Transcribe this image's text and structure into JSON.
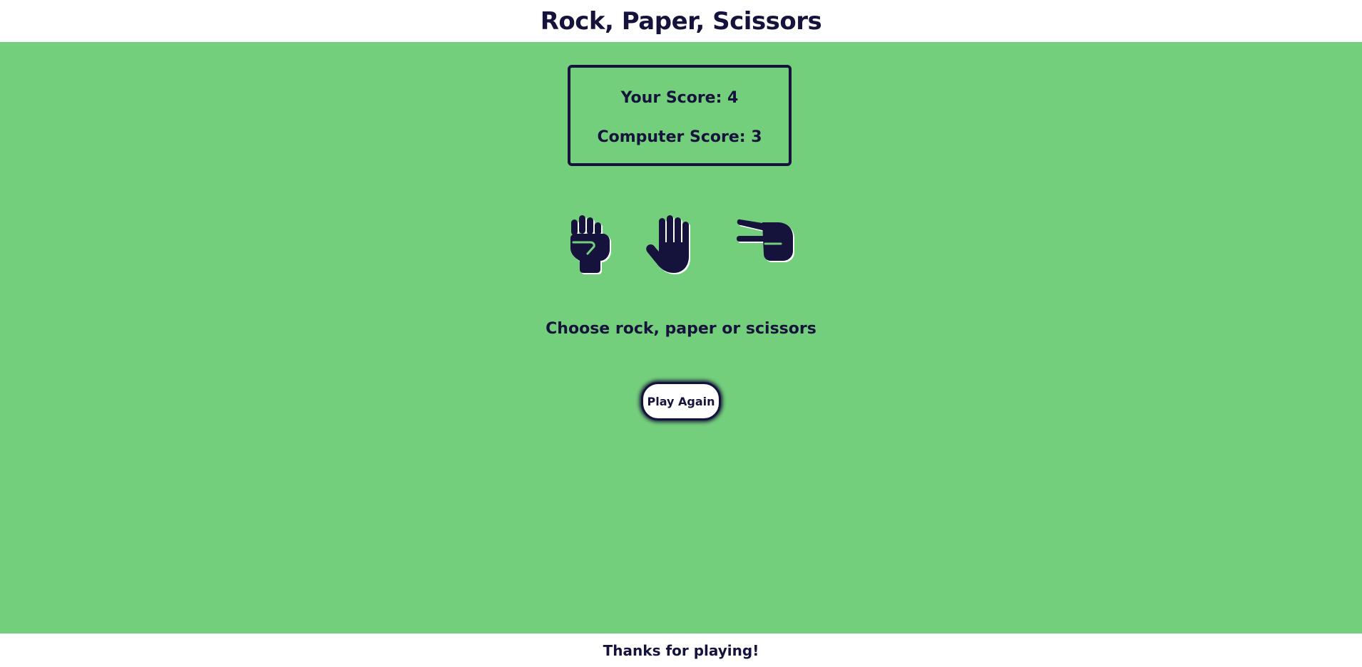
{
  "header": {
    "title": "Rock, Paper, Scissors"
  },
  "scoreboard": {
    "your_score_text": "Your Score: 4",
    "computer_score_text": "Computer Score: 3",
    "your_score": 4,
    "computer_score": 3
  },
  "choices": [
    {
      "name": "rock",
      "icon": "fist-icon"
    },
    {
      "name": "paper",
      "icon": "open-hand-icon"
    },
    {
      "name": "scissors",
      "icon": "peace-hand-icon"
    }
  ],
  "prompt": "Choose rock, paper or scissors",
  "play_again_label": "Play Again",
  "footer": {
    "text": "Thanks for playing!"
  },
  "colors": {
    "background": "#74cf7c",
    "ink": "#15133c",
    "surface": "#ffffff"
  }
}
